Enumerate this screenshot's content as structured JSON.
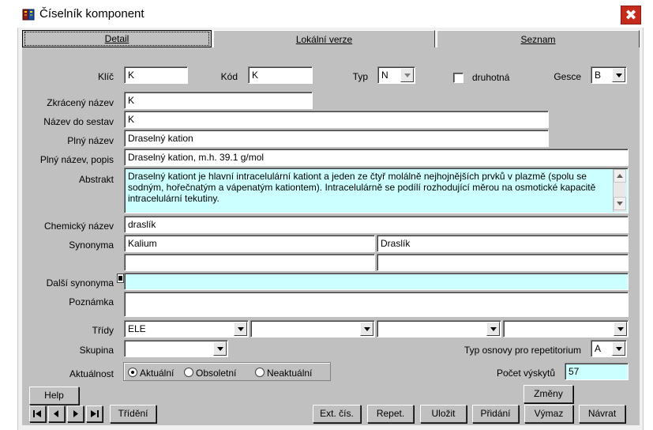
{
  "window": {
    "title": "Číselník komponent",
    "close_glyph": "✖",
    "icon": "app-book-icon"
  },
  "tabs": [
    {
      "label": "Detail",
      "active": true
    },
    {
      "label": "Lokální verze",
      "active": false
    },
    {
      "label": "Seznam",
      "active": false
    }
  ],
  "form": {
    "klic": {
      "label": "Klíč",
      "value": "K"
    },
    "kod": {
      "label": "Kód",
      "value": "K"
    },
    "typ": {
      "label": "Typ",
      "value": "N"
    },
    "druhotna": {
      "label": "druhotná",
      "checked": false
    },
    "gesce": {
      "label": "Gesce",
      "value": "B"
    },
    "zkraceny_nazev": {
      "label": "Zkrácený název",
      "value": "K"
    },
    "nazev_do_sestav": {
      "label": "Název do sestav",
      "value": "K"
    },
    "plny_nazev": {
      "label": "Plný název",
      "value": "Draselný kation"
    },
    "plny_nazev_popis": {
      "label": "Plný název, popis",
      "value": "Draselný kation, m.h. 39.1 g/mol"
    },
    "abstrakt": {
      "label": "Abstrakt",
      "line1": "Draselný kationt je hlavní intracelulární kationt a jeden ze čtyř molálně nejhojnějších prvků v plazmě (spolu se",
      "line2": "sodným, hořečnatým a vápenatým kationtem). Intracelulárně se podílí rozhodující měrou na osmotické kapacitě",
      "line3": "intracelulární tekutiny."
    },
    "chemicky_nazev": {
      "label": "Chemický název",
      "value": "draslík"
    },
    "synonyma": {
      "label": "Synonyma",
      "values": [
        "Kalium",
        "Draslík",
        "",
        ""
      ]
    },
    "dalsi_synonyma": {
      "label": "Další synonyma",
      "value": ""
    },
    "poznamka": {
      "label": "Poznámka",
      "value": ""
    },
    "tridy": {
      "label": "Třídy",
      "values": [
        "ELE",
        "",
        "",
        ""
      ]
    },
    "skupina": {
      "label": "Skupina",
      "value": ""
    },
    "typ_osnovy": {
      "label": "Typ osnovy pro repetitorium",
      "value": "A"
    },
    "aktualnost": {
      "label": "Aktuálnost",
      "options": [
        "Aktuální",
        "Obsoletní",
        "Neaktuální"
      ],
      "selected": "Aktuální"
    },
    "pocet_vyskytu": {
      "label": "Počet výskytů",
      "value": "57"
    }
  },
  "buttons": {
    "help": "Help",
    "zmeny": "Změny",
    "trideni": "Třídění",
    "ext_cis": "Ext. čís.",
    "repet": "Repet.",
    "ulozit": "Uložit",
    "pridani": "Přidání",
    "vymaz": "Výmaz",
    "navrat": "Návrat"
  },
  "colors": {
    "panel": "#c0c0c0",
    "highlight_field": "#ccffff",
    "close_button": "#c42b1c"
  }
}
